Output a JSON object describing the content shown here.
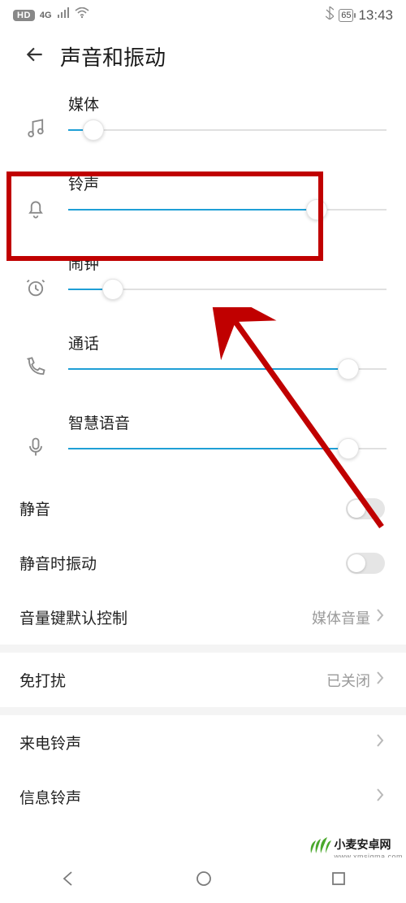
{
  "status_bar": {
    "hd": "HD",
    "net": "4G",
    "battery": "65",
    "time": "13:43"
  },
  "header": {
    "title": "声音和振动"
  },
  "sliders": {
    "media": {
      "label": "媒体",
      "value_pct": 8
    },
    "ring": {
      "label": "铃声",
      "value_pct": 78
    },
    "alarm": {
      "label": "闹钟",
      "value_pct": 14
    },
    "call": {
      "label": "通话",
      "value_pct": 88
    },
    "ai_voice": {
      "label": "智慧语音",
      "value_pct": 88
    }
  },
  "settings": {
    "mute": {
      "label": "静音",
      "on": false
    },
    "vibrate_on_mute": {
      "label": "静音时振动",
      "on": false
    },
    "vol_key_default": {
      "label": "音量键默认控制",
      "value": "媒体音量"
    },
    "dnd": {
      "label": "免打扰",
      "value": "已关闭"
    },
    "incoming_tone": {
      "label": "来电铃声"
    },
    "message_tone": {
      "label": "信息铃声"
    }
  },
  "annotation": {
    "arrow_target": "ring-slider"
  },
  "watermark": {
    "brand": "小麦安卓网",
    "url": "www.xmsigma.com"
  }
}
